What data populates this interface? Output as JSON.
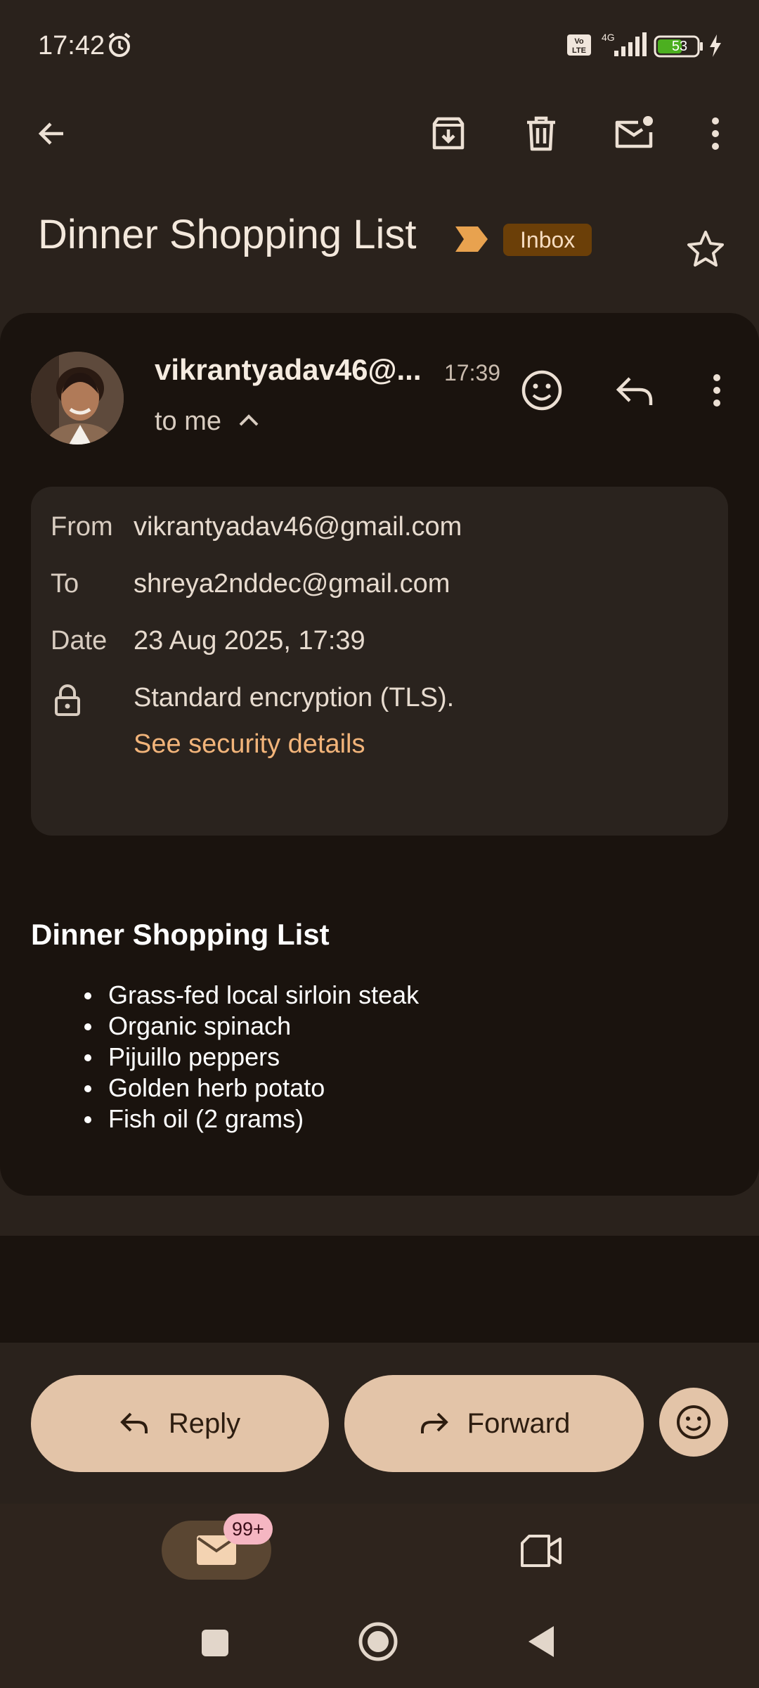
{
  "status_bar": {
    "time": "17:42",
    "network": "4G",
    "battery_level": "53"
  },
  "toolbar": {
    "back": "back-arrow-icon",
    "archive": "archive-icon",
    "delete": "trash-icon",
    "mark_unread": "mark-unread-icon",
    "more": "more-vert-icon"
  },
  "email": {
    "subject": "Dinner Shopping List",
    "label": "Inbox",
    "sender_display": "vikrantyadav46@...",
    "time": "17:39",
    "recipient_line": "to me",
    "details": {
      "from_label": "From",
      "from_value": "vikrantyadav46@gmail.com",
      "to_label": "To",
      "to_value": "shreya2nddec@gmail.com",
      "date_label": "Date",
      "date_value": "23 Aug 2025, 17:39",
      "encryption": "Standard encryption (TLS).",
      "security_link": "See security details"
    },
    "body": {
      "heading": "Dinner Shopping List",
      "items": [
        "Grass-fed local sirloin steak",
        "Organic spinach",
        "Pijuillo peppers",
        "Golden herb potato",
        "Fish oil (2 grams)"
      ]
    }
  },
  "actions": {
    "reply_label": "Reply",
    "forward_label": "Forward"
  },
  "bottom_nav": {
    "mail_badge": "99+"
  },
  "colors": {
    "background": "#2a221c",
    "card": "#1a130e",
    "accent_pill": "#e3c4a8",
    "link": "#f2b47a",
    "label_chip": "#6b3f08",
    "importance": "#e8a24f"
  }
}
